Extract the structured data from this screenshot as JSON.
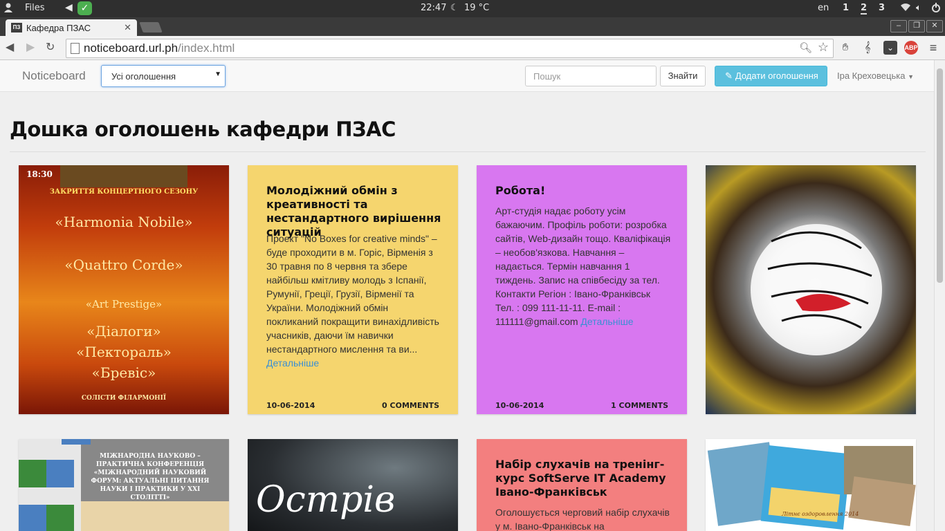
{
  "os_bar": {
    "files_label": "Files",
    "time": "22:47",
    "weather": "19 °C",
    "keyboard_layout": "en",
    "workspaces": [
      "1",
      "2",
      "3"
    ],
    "active_workspace": "2"
  },
  "browser": {
    "tab_title": "Кафедра ПЗАС",
    "favicon_text": "ПЗ",
    "url_host": "noticeboard.url.ph",
    "url_path": "/index.html",
    "abp_label": "ABP"
  },
  "navbar": {
    "brand": "Noticeboard",
    "filter_selected": "Усі оголошення",
    "search_placeholder": "Пошук",
    "search_button": "Знайти",
    "add_button": "Додати оголошення",
    "user_name": "Іра Креховецька"
  },
  "page": {
    "title": "Дошка оголошень кафедри ПЗАС"
  },
  "cards": {
    "poster1": {
      "time": "18:30",
      "lines": [
        "ЗАКРИТТЯ КОНЦЕРТНОГО СЕЗОНУ",
        "«Harmonia Nobile»",
        "«Quattro Corde»",
        "«Art Prestige»",
        "«Діалоги»",
        "«Пектораль»",
        "«Бревіс»",
        "СОЛІСТИ ФІЛАРМОНІЇ"
      ]
    },
    "exchange": {
      "title": "Молодіжний обмін з креативності та нестандартного вирішення ситуацій",
      "text": "Проект \"No Boxes for creative minds\" – буде проходити в м. Горіс, Вірменія з 30 травня по 8 червня та збере найбільш кмітливу молодь з Іспанії, Румунії, Греції, Грузії, Вірменії та України. Молодіжний обмін покликаний покращити винахідливість учасників, даючи їм навички нестандартного мислення та ви...",
      "more": "Детальніше",
      "date": "10-06-2014",
      "comments": "0 COMMENTS",
      "bg": "#f5d56e"
    },
    "job": {
      "title": "Робота!",
      "text": "Арт-студія надає роботу усім бажаючим. Профіль роботи: розробка сайтів, Web-дизайн тощо. Кваліфікація – необов'язкова. Навчання – надається. Термін навчання 1 тиждень. Запис на співбесіду за тел. Контакти Регіон : Івано-Франківськ Тел. : 099 111-11-11. E-mail : 111111@gmail.com",
      "more": "Детальніше",
      "date": "10-06-2014",
      "comments": "1 COMMENTS",
      "bg": "#d877f0"
    },
    "conference": {
      "text": "МІЖНАРОДНА НАУКОВО – ПРАКТИЧНА КОНФЕРЕНЦІЯ «МІЖНАРОДНИЙ НАУКОВИЙ ФОРУМ: АКТУАЛЬНІ ПИТАННЯ НАУКИ І ПРАКТИКИ У XXI СТОЛІТТІ»"
    },
    "island": {
      "text": "Острів"
    },
    "softserve": {
      "title": "Набір слухачів на тренінг-курс SoftServe IT Academy Івано-Франківськ",
      "text": "Оголошується черговий набір слухачів у м. Івано-Франківськ на",
      "bg": "#f37f7f"
    },
    "summer": {
      "text": "Літнє оздоровлення 2014"
    }
  }
}
